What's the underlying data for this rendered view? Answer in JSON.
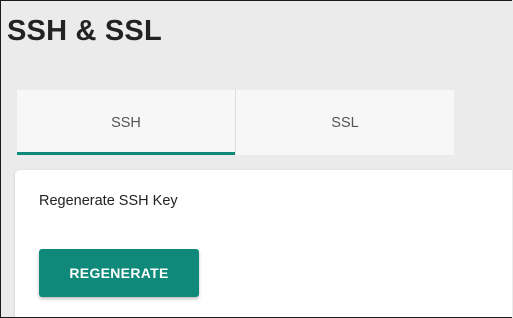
{
  "page": {
    "title": "SSH & SSL"
  },
  "tabs": [
    {
      "label": "SSH",
      "active": true
    },
    {
      "label": "SSL",
      "active": false
    }
  ],
  "ssh_panel": {
    "label": "Regenerate SSH Key",
    "button_label": "REGENERATE"
  },
  "colors": {
    "accent": "#0f8a7a",
    "background": "#ebebeb",
    "card": "#ffffff"
  }
}
